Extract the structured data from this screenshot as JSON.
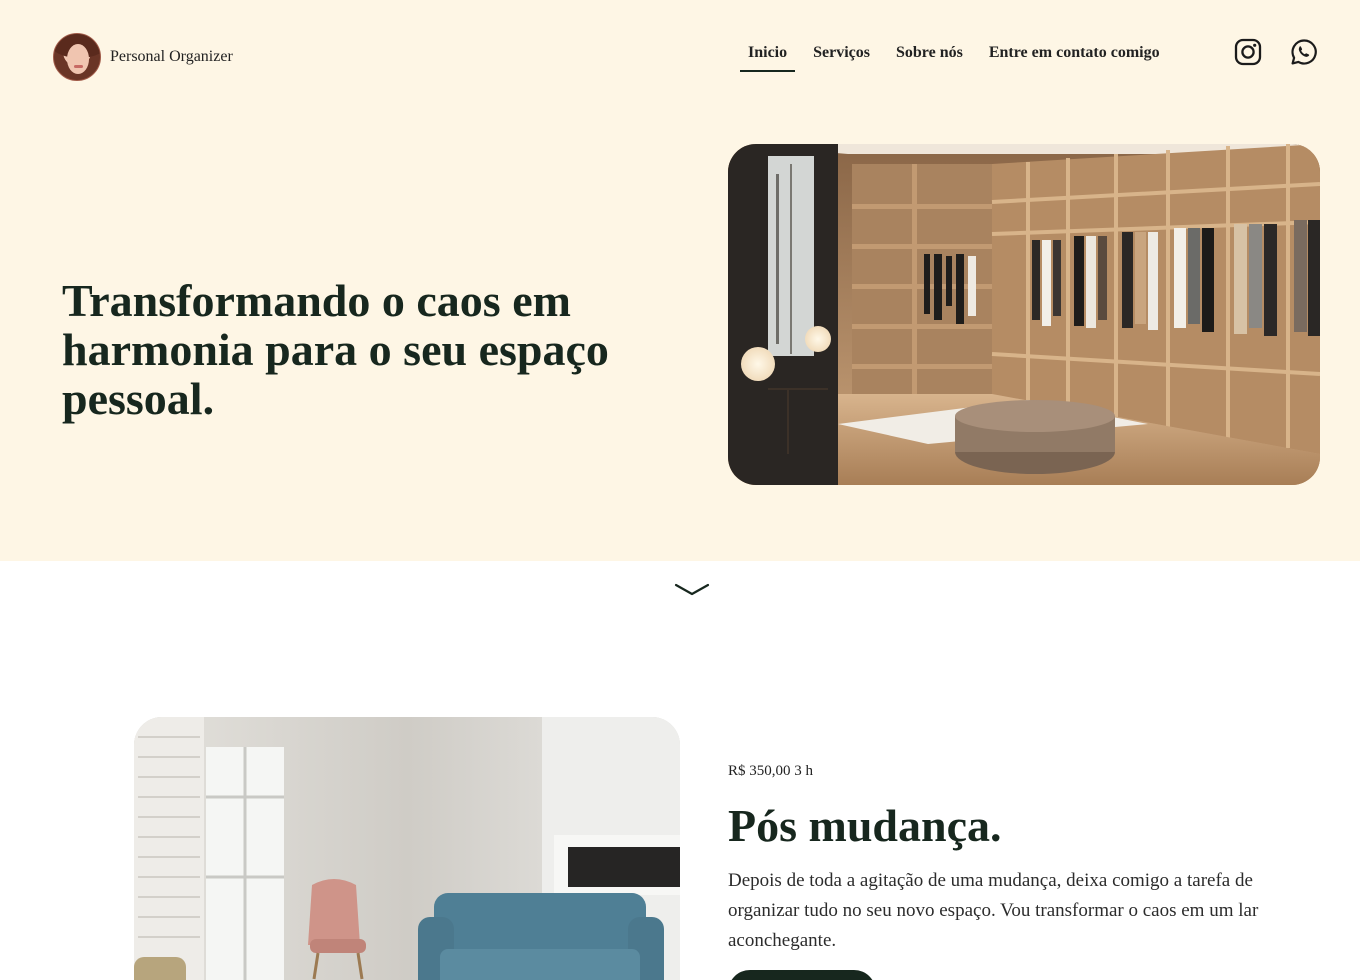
{
  "brand": {
    "name": "Personal Organizer",
    "avatar_icon": "avatar-portrait"
  },
  "nav": {
    "items": [
      "Inicio",
      "Serviços",
      "Sobre nós",
      "Entre em contato comigo"
    ],
    "active": "Inicio"
  },
  "social": {
    "icons": [
      "instagram-icon",
      "whatsapp-icon"
    ]
  },
  "hero": {
    "title": "Transformando o caos em harmonia para o seu espaço pessoal.",
    "image": "walk-in-closet-photo"
  },
  "scroll_icon": "chevron-down-icon",
  "service": {
    "price": "R$ 350,00 3 h",
    "title": "Pós mudança.",
    "description": "Depois de toda a agitação de uma mudança, deixa comigo a tarefa de organizar tudo no seu novo espaço. Vou transformar o caos em um lar aconchegante.",
    "image": "living-room-photo"
  },
  "colors": {
    "hero_bg": "#fef6e5",
    "text_dark_green": "#17271e",
    "page_bg": "#ffffff"
  }
}
